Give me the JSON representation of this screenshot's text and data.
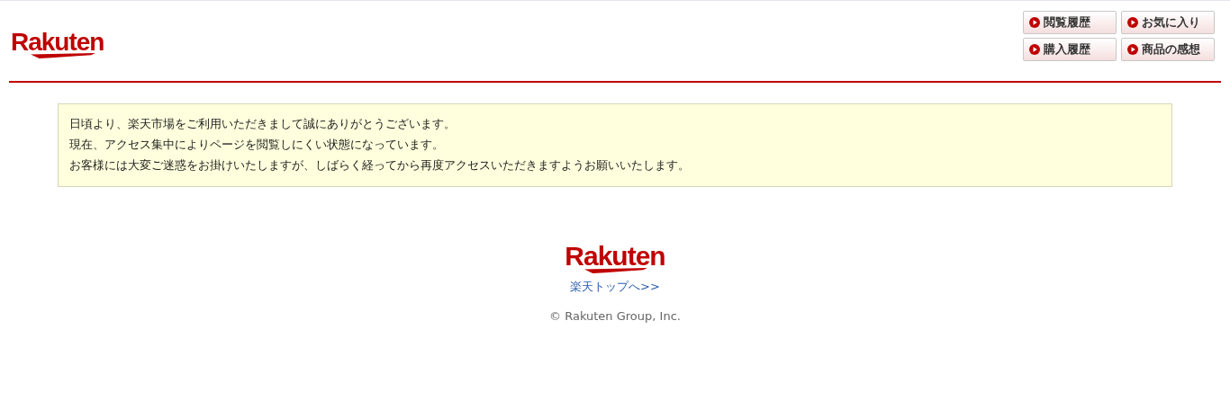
{
  "header": {
    "logo": "Rakuten",
    "buttons": [
      {
        "label": "閲覧履歴"
      },
      {
        "label": "お気に入り"
      },
      {
        "label": "購入履歴"
      },
      {
        "label": "商品の感想"
      }
    ]
  },
  "notice": {
    "lines": [
      "日頃より、楽天市場をご利用いただきまして誠にありがとうございます。",
      "現在、アクセス集中によりページを閲覧しにくい状態になっています。",
      "お客様には大変ご迷惑をお掛けいたしますが、しばらく経ってから再度アクセスいただきますようお願いいたします。"
    ]
  },
  "footer": {
    "logo": "Rakuten",
    "link": "楽天トップへ>>",
    "copyright": "© Rakuten Group, Inc."
  }
}
